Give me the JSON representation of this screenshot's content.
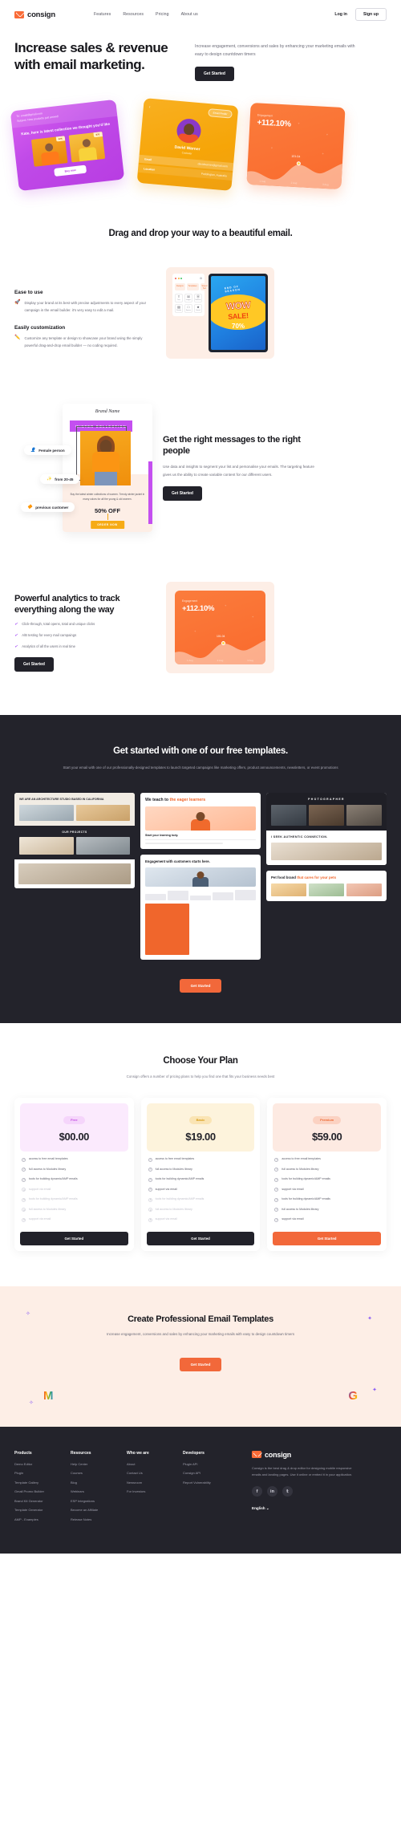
{
  "brand": {
    "name": "consign",
    "icon": "envelope-icon"
  },
  "nav": {
    "links": [
      "Features",
      "Resources",
      "Pricing",
      "About us"
    ],
    "login": "Log in",
    "signup": "Sign up"
  },
  "hero": {
    "title": "Increase sales & revenue with email marketing.",
    "subtitle": "Increase engagement, conversions and sales by enhancing your marketing emails with easy to design countdown timers",
    "cta": "Get Started",
    "cards": {
      "purple": {
        "to": "To: email@gmail.com",
        "subject": "Subject: New products just arrived!",
        "headline": "Kate, here is latest collection we thought you'd like",
        "price1": "$75",
        "price2": "$70",
        "buy": "Buy now"
      },
      "yellow": {
        "back": "‹",
        "pill": "Email Finder",
        "name": "David Warner",
        "role": "Cricketer",
        "email_label": "Email",
        "email_value": "davidwarner@gmail.com",
        "location_label": "Location",
        "location_value": "Paddington, Australia"
      },
      "orange": {
        "label": "Engagement",
        "value": "+112.10%",
        "point": "101.04",
        "axis": [
          "1 Aug",
          "2 Aug",
          "3 Aug"
        ]
      }
    }
  },
  "dragdrop": {
    "title": "Drag and drop your way to a beautiful email.",
    "features": [
      {
        "icon": "rocket-icon",
        "heading": "Ease to use",
        "text": "Display your brand at its best with precise adjustments to every aspect of your campaign in the email builder. it's very easy to edit a mail."
      },
      {
        "icon": "pencil-icon",
        "heading": "Easily customization",
        "text": "Customize any template or design to showcase your brand using the simply powerful drag-and-drop email builder — no coding required."
      }
    ],
    "editor": {
      "tabs": [
        "Designs",
        "Templates",
        "Saved Text"
      ],
      "tools": [
        {
          "glyph": "T",
          "label": "Text"
        },
        {
          "glyph": "☒",
          "label": "Images"
        },
        {
          "glyph": "Ⓐ",
          "label": "Buttons"
        },
        {
          "glyph": "▤",
          "label": "Divider"
        },
        {
          "glyph": "□",
          "label": "Spacer"
        },
        {
          "glyph": "★",
          "label": "Social"
        }
      ],
      "canvas": {
        "eyebrow": "END OF SEASON",
        "wow": "WOW",
        "sale": "SALE!",
        "discount": "70%"
      }
    }
  },
  "messages": {
    "title": "Get the right messages to the right people",
    "text": "Use data and insights to segment your list and personalise your emails. The targeting feature gives us the ability to create variable content for our different users.",
    "cta": "Get Started",
    "tags": [
      {
        "icon": "female-icon",
        "label": "Female person"
      },
      {
        "icon": "age-icon",
        "label": "from 20-45"
      },
      {
        "icon": "customer-icon",
        "label": "previous customer"
      }
    ],
    "card": {
      "brand": "Brand Name",
      "collection": "WINTER COLLECTION",
      "desc": "Buy the latest winter collections of women. Trendy winter jacket in many colors for all the young & old women.",
      "off": "50% OFF",
      "order": "ORDER NOW"
    }
  },
  "analytics": {
    "title": "Powerful analytics to track everything along the way",
    "bullets": [
      "Click-through, total opens, total and unique clicks",
      "A/B testing for every mail campaings",
      "Analytics of all the users in real time"
    ],
    "cta": "Get Started",
    "card": {
      "label": "Engagement",
      "value": "+112.10%",
      "point": "101.04",
      "axis": [
        "1 Aug",
        "2 Aug",
        "3 Aug"
      ]
    }
  },
  "templates": {
    "title": "Get started with one of our free templates.",
    "subtitle": "Start your email with one of our professionally-designed templates to launch targeted campaigns like marketing offers, product announcements, newsletters, or event promotions",
    "cta": "Get Started",
    "cards": {
      "architecture": {
        "headline": "WE ARE AN ARCHITECTURE STUDIO BASED IN CALIFORNIA",
        "caption": "OUR PROJECTS"
      },
      "teach": {
        "headline_a": "We teach to",
        "headline_b": "the eager learners",
        "sub": "Start your learning tody."
      },
      "photographer": {
        "caption": "PHOTOGRAPHER",
        "auth": "I SEEK AUTHENTIC CONNECTION."
      },
      "engagement": {
        "headline": "Engagement with customers starts here."
      },
      "pet": {
        "headline_a": "Pet food brand",
        "headline_b": "that cares for your pets"
      }
    }
  },
  "pricing": {
    "title": "Choose Your Plan",
    "subtitle": "Consign offers a number of pricing plans to help you find one that fits your business needs best",
    "plans": [
      {
        "badge": "Free",
        "price": "$00.00",
        "cta": "Get Started",
        "features": [
          {
            "text": "access to free email templates",
            "enabled": true
          },
          {
            "text": "full access to Modules library",
            "enabled": true
          },
          {
            "text": "tools for building dynamic/AMP emails",
            "enabled": true
          },
          {
            "text": "support via email",
            "enabled": false
          },
          {
            "text": "tools for building dynamic/AMP emails",
            "enabled": false
          },
          {
            "text": "full access to Modules library",
            "enabled": false
          },
          {
            "text": "support via email",
            "enabled": false
          }
        ]
      },
      {
        "badge": "Basic",
        "price": "$19.00",
        "cta": "Get Started",
        "features": [
          {
            "text": "access to free email templates",
            "enabled": true
          },
          {
            "text": "full access to Modules library",
            "enabled": true
          },
          {
            "text": "tools for building dynamic/AMP emails",
            "enabled": true
          },
          {
            "text": "support via email",
            "enabled": true
          },
          {
            "text": "tools for building dynamic/AMP emails",
            "enabled": false
          },
          {
            "text": "full access to Modules library",
            "enabled": false
          },
          {
            "text": "support via email",
            "enabled": false
          }
        ]
      },
      {
        "badge": "Premium",
        "price": "$59.00",
        "cta": "Get Started",
        "features": [
          {
            "text": "access to free email templates",
            "enabled": true
          },
          {
            "text": "full access to Modules library",
            "enabled": true
          },
          {
            "text": "tools for building dynamic/AMP emails",
            "enabled": true
          },
          {
            "text": "support via email",
            "enabled": true
          },
          {
            "text": "tools for building dynamic/AMP emails",
            "enabled": true
          },
          {
            "text": "full access to Modules library",
            "enabled": true
          },
          {
            "text": "support via email",
            "enabled": true
          }
        ]
      }
    ]
  },
  "cta_section": {
    "title": "Create Professional Email Templates",
    "text": "Increase engagement, conversions and sales by enhancing your marketing emails with easy to design countdown timers",
    "button": "Get Started",
    "logo_left": "M",
    "logo_right": "G"
  },
  "footer": {
    "columns": [
      {
        "heading": "Products",
        "links": [
          "Demo Editor",
          "Plugin",
          "Template Gallery",
          "Gmail Promo Builder",
          "Brand Kit Generator",
          "Template Generator",
          "AMP - Examples"
        ]
      },
      {
        "heading": "Resources",
        "links": [
          "Help Center",
          "Courses",
          "Blog",
          "Webinars",
          "ESP Integrations",
          "Become an Affiliate",
          "Release Notes"
        ]
      },
      {
        "heading": "Who we are",
        "links": [
          "About",
          "Contact Us",
          "Newsroom",
          "For Investors"
        ]
      },
      {
        "heading": "Developers",
        "links": [
          "Plugin API",
          "Consign API",
          "Report Vulnerability"
        ]
      }
    ],
    "brand": "consign",
    "description": "Consign is the best drag & drop editor for designing mobile responsive emails and landing pages. Use it online or embed it in your application.",
    "socials": [
      "facebook-icon",
      "linkedin-icon",
      "twitter-icon"
    ],
    "language": "English"
  },
  "colors": {
    "accent": "#f2683a",
    "dark": "#23232b",
    "purple": "#c44ff0",
    "yellow": "#f6ab15"
  }
}
